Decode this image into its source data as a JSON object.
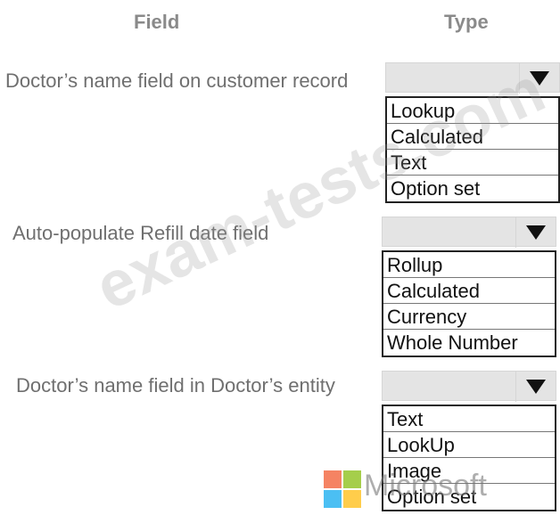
{
  "headers": {
    "field": "Field",
    "type": "Type"
  },
  "rows": [
    {
      "label": "Doctor’s name field on customer record",
      "options": [
        "Lookup",
        "Calculated",
        "Text",
        "Option set"
      ]
    },
    {
      "label": "Auto-populate Refill date field",
      "options": [
        "Rollup",
        "Calculated",
        "Currency",
        "Whole Number"
      ]
    },
    {
      "label": "Doctor’s name field in Doctor’s entity",
      "options": [
        "Text",
        "LookUp",
        "Image",
        "Option set"
      ]
    }
  ],
  "watermark": {
    "text": "exam-tests.com"
  },
  "logo": {
    "text": "Microsoft",
    "colors": [
      "#f25022",
      "#7fba00",
      "#00a4ef",
      "#ffb900"
    ]
  }
}
